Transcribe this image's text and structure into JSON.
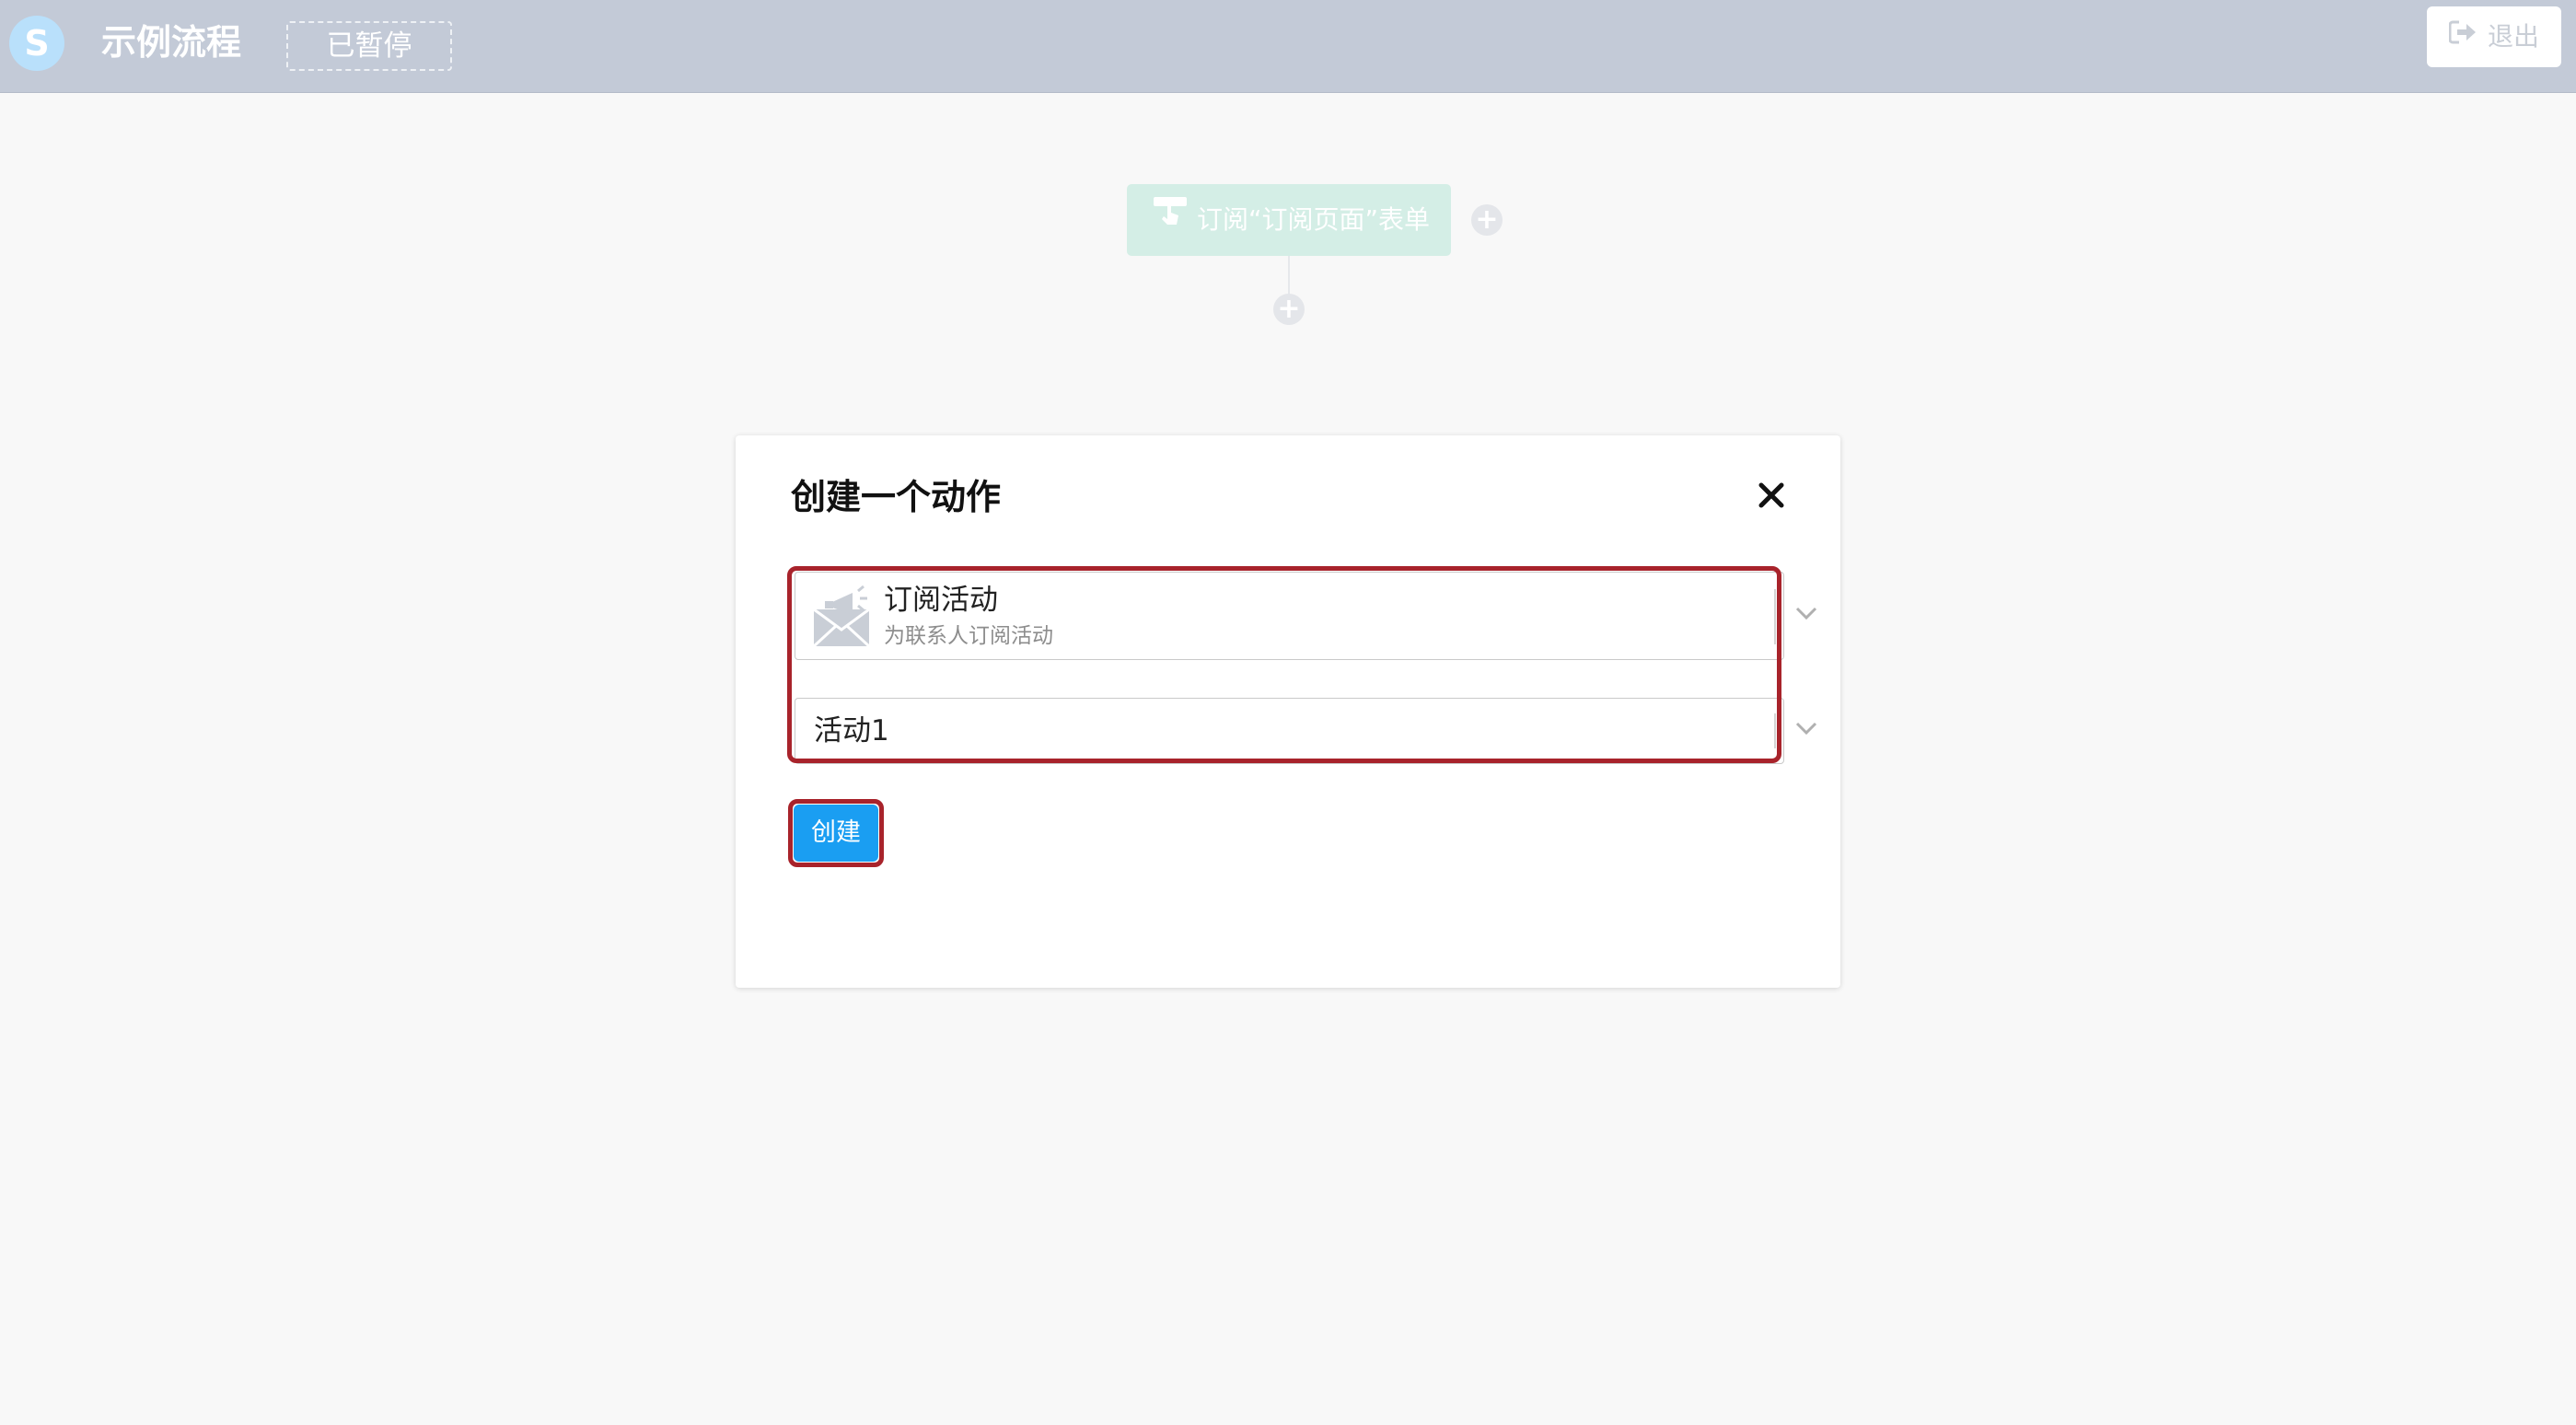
{
  "header": {
    "logo_letter": "S",
    "flow_title": "示例流程",
    "status": "已暂停",
    "logout_label": "退出"
  },
  "canvas": {
    "trigger_node_label": "订阅“订阅页面”表单",
    "add_symbol": "+"
  },
  "modal": {
    "title": "创建一个动作",
    "action_select": {
      "name": "订阅活动",
      "description": "为联系人订阅活动",
      "icon": "envelope-megaphone-icon"
    },
    "campaign_select": {
      "value": "活动1"
    },
    "create_button_label": "创建"
  },
  "colors": {
    "header_bg": "#c3cad7",
    "highlight_border": "#a8232b",
    "primary_button": "#1a9ef2",
    "trigger_node_bg": "#d4eee6"
  }
}
